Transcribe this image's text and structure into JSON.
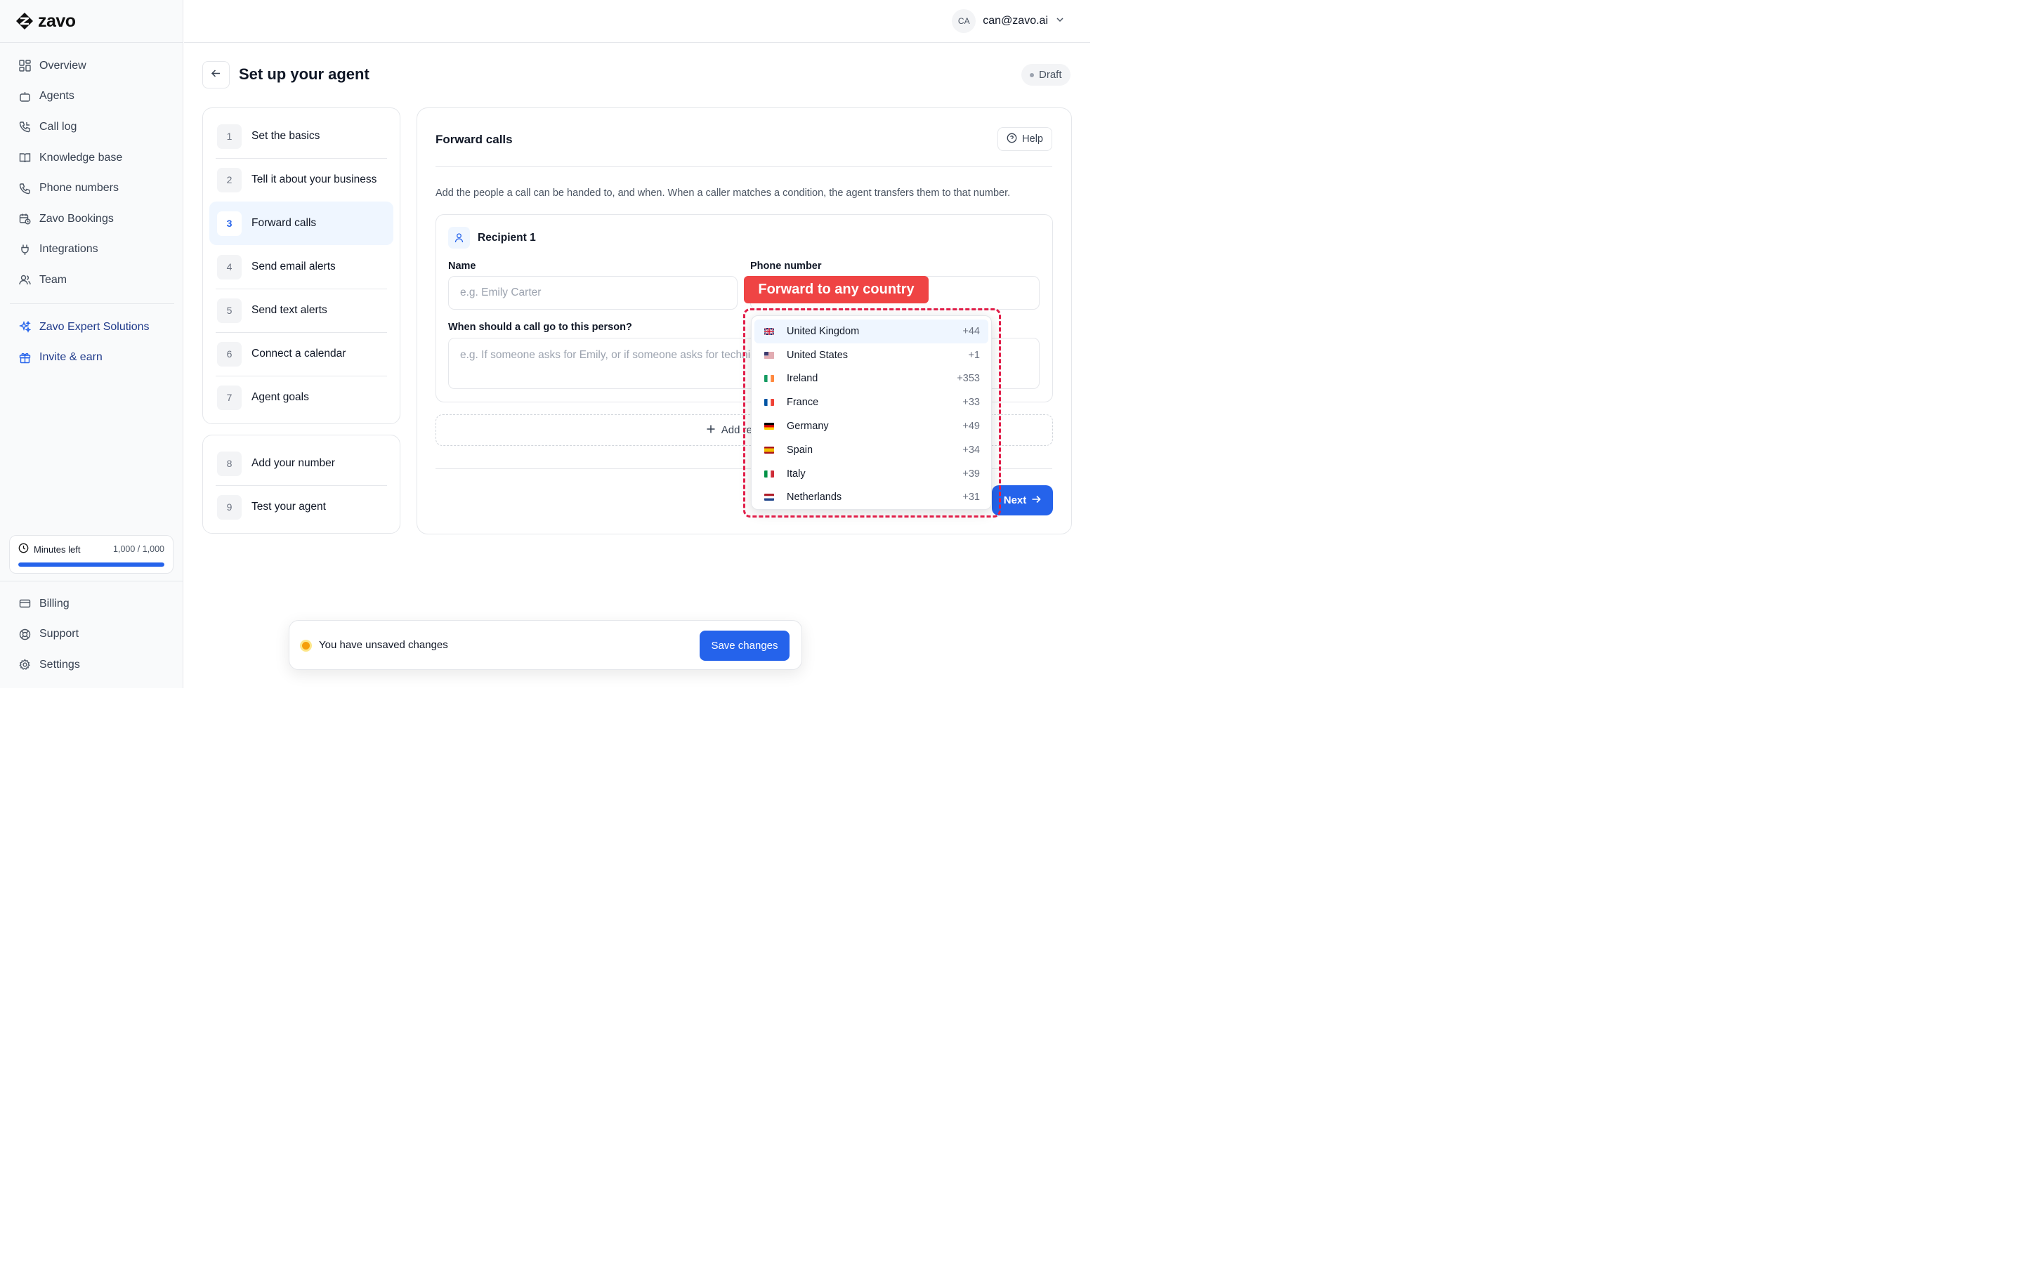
{
  "brand": {
    "name": "zavo"
  },
  "sidebar": {
    "items": [
      {
        "label": "Overview",
        "icon": "grid-icon"
      },
      {
        "label": "Agents",
        "icon": "bot-icon"
      },
      {
        "label": "Call log",
        "icon": "phone-log-icon"
      },
      {
        "label": "Knowledge base",
        "icon": "book-icon"
      },
      {
        "label": "Phone numbers",
        "icon": "phone-icon"
      },
      {
        "label": "Zavo Bookings",
        "icon": "calendar-clock-icon"
      },
      {
        "label": "Integrations",
        "icon": "plug-icon"
      },
      {
        "label": "Team",
        "icon": "users-icon"
      }
    ],
    "extra": [
      {
        "label": "Zavo Expert Solutions",
        "icon": "sparkles-icon"
      },
      {
        "label": "Invite & earn",
        "icon": "gift-icon"
      }
    ],
    "minutes": {
      "label": "Minutes left",
      "value": "1,000 / 1,000",
      "fraction": 1.0
    },
    "bottom": [
      {
        "label": "Billing",
        "icon": "credit-card-icon"
      },
      {
        "label": "Support",
        "icon": "lifebuoy-icon"
      },
      {
        "label": "Settings",
        "icon": "gear-icon"
      }
    ]
  },
  "header": {
    "user_initials": "CA",
    "user_email": "can@zavo.ai",
    "page_title": "Set up your agent",
    "status": "Draft"
  },
  "steps": [
    {
      "num": "1",
      "label": "Set the basics"
    },
    {
      "num": "2",
      "label": "Tell it about your business"
    },
    {
      "num": "3",
      "label": "Forward calls",
      "active": true
    },
    {
      "num": "4",
      "label": "Send email alerts"
    },
    {
      "num": "5",
      "label": "Send text alerts"
    },
    {
      "num": "6",
      "label": "Connect a calendar"
    },
    {
      "num": "7",
      "label": "Agent goals"
    }
  ],
  "steps_extra": [
    {
      "num": "8",
      "label": "Add your number"
    },
    {
      "num": "9",
      "label": "Test your agent"
    }
  ],
  "main": {
    "title": "Forward calls",
    "help_label": "Help",
    "description": "Add the people a call can be handed to, and when. When a caller matches a condition, the agent transfers them to that number.",
    "recipient": {
      "title": "Recipient 1",
      "name_label": "Name",
      "name_placeholder": "e.g. Emily Carter",
      "phone_label": "Phone number",
      "condition_label": "When should a call go to this person?",
      "condition_placeholder": "e.g. If someone asks for Emily, or if someone asks for technical support"
    },
    "add_recipient_label": "Add recipient",
    "next_label": "Next"
  },
  "callout": "Forward to any country",
  "countries": [
    {
      "name": "United Kingdom",
      "dial": "+44",
      "flag": "uk",
      "selected": true
    },
    {
      "name": "United States",
      "dial": "+1",
      "flag": "us"
    },
    {
      "name": "Ireland",
      "dial": "+353",
      "flag": "ie"
    },
    {
      "name": "France",
      "dial": "+33",
      "flag": "fr"
    },
    {
      "name": "Germany",
      "dial": "+49",
      "flag": "de"
    },
    {
      "name": "Spain",
      "dial": "+34",
      "flag": "es"
    },
    {
      "name": "Italy",
      "dial": "+39",
      "flag": "it"
    },
    {
      "name": "Netherlands",
      "dial": "+31",
      "flag": "nl"
    }
  ],
  "unsaved": {
    "message": "You have unsaved changes",
    "save_label": "Save changes"
  },
  "colors": {
    "accent": "#2563eb",
    "callout": "#ef4444",
    "unsaved_dot": "#f59e0b"
  }
}
